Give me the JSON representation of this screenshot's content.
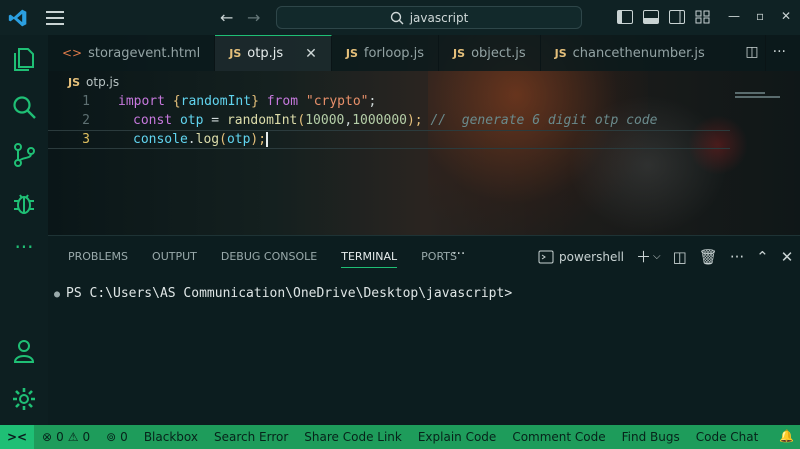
{
  "titlebar": {
    "search_text": "javascript",
    "minimize": "—",
    "maximize": "▫",
    "close": "✕"
  },
  "tabs": [
    {
      "icon": "<>",
      "label": "storagevent.html",
      "type": "html"
    },
    {
      "icon": "JS",
      "label": "otp.js",
      "type": "js",
      "active": true
    },
    {
      "icon": "JS",
      "label": "forloop.js",
      "type": "js"
    },
    {
      "icon": "JS",
      "label": "object.js",
      "type": "js"
    },
    {
      "icon": "JS",
      "label": "chancethenumber.js",
      "type": "js"
    }
  ],
  "breadcrumb": {
    "icon": "JS",
    "file": "otp.js"
  },
  "code": {
    "line_numbers": [
      "1",
      "2",
      "3"
    ],
    "l1": {
      "kw": "import",
      "open": "{",
      "id": "randomInt",
      "close": "}",
      "from": "from",
      "str": "\"crypto\"",
      "end": ";"
    },
    "l2": {
      "kw": "const",
      "id": "otp",
      "eq": " = ",
      "fn": "randomInt",
      "args_open": "(",
      "n1": "10000",
      "comma": ",",
      "n2": "1000000",
      "args_close": ");",
      "cmt": "//  generate 6 digit otp code"
    },
    "l3": {
      "obj": "console",
      "dot": ".",
      "fn": "log",
      "open": "(",
      "arg": "otp",
      "close": ");"
    }
  },
  "panel": {
    "tabs": [
      "PROBLEMS",
      "OUTPUT",
      "DEBUG CONSOLE",
      "TERMINAL",
      "PORTS"
    ],
    "active_tab": "TERMINAL",
    "shell": "powershell",
    "prompt": "PS C:\\Users\\AS Communication\\OneDrive\\Desktop\\javascript>"
  },
  "statusbar": {
    "errors": "0",
    "warnings": "0",
    "ports": "0",
    "items": [
      "Blackbox",
      "Search Error",
      "Share Code Link",
      "Explain Code",
      "Comment Code",
      "Find Bugs",
      "Code Chat"
    ]
  },
  "colors": {
    "accent": "#1fbf75",
    "statusbar": "#1e9c5b",
    "background": "#0b1a1c"
  }
}
